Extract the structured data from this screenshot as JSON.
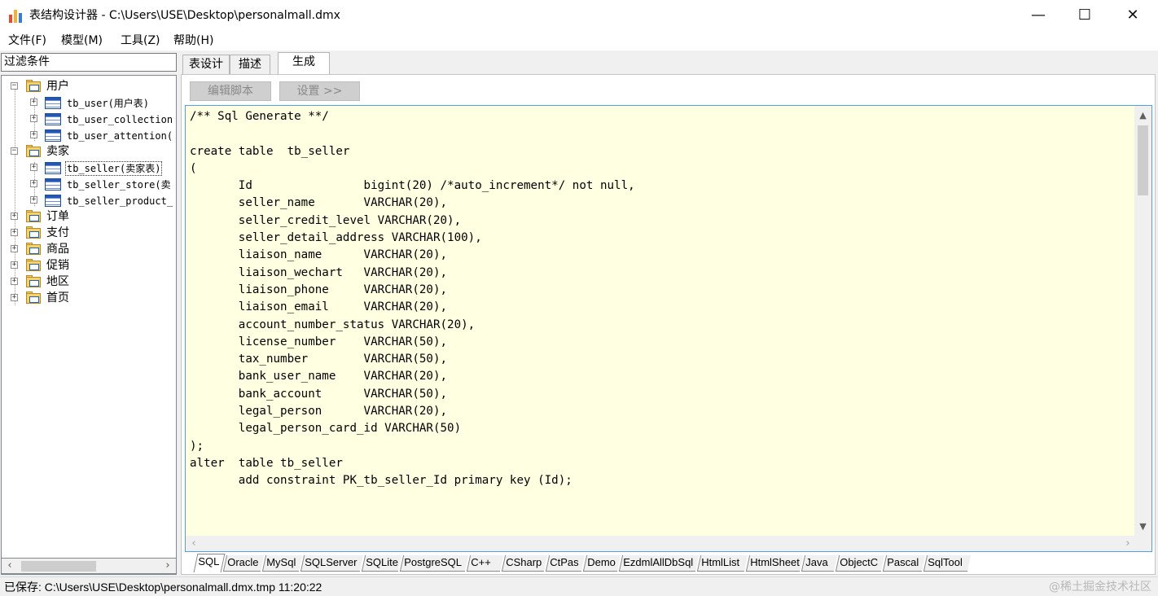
{
  "window": {
    "title": "表结构设计器 - C:\\Users\\USE\\Desktop\\personalmall.dmx",
    "controls": {
      "minimize": "—",
      "maximize": "☐",
      "close": "✕"
    }
  },
  "menu": {
    "items": [
      "文件(F)",
      "模型(M)",
      "工具(Z)",
      "帮助(H)"
    ]
  },
  "sidebar": {
    "filter_text": "过滤条件",
    "tree": [
      {
        "label": "用户",
        "type": "folder",
        "expanded": true,
        "level": 0
      },
      {
        "label": "tb_user(用户表)",
        "type": "table",
        "level": 1
      },
      {
        "label": "tb_user_collection",
        "type": "table",
        "level": 1
      },
      {
        "label": "tb_user_attention(",
        "type": "table",
        "level": 1
      },
      {
        "label": "卖家",
        "type": "folder",
        "expanded": true,
        "level": 0
      },
      {
        "label": "tb_seller(卖家表)",
        "type": "table",
        "level": 1,
        "selected": true
      },
      {
        "label": "tb_seller_store(卖",
        "type": "table",
        "level": 1
      },
      {
        "label": "tb_seller_product_",
        "type": "table",
        "level": 1
      },
      {
        "label": "订单",
        "type": "folder",
        "expanded": false,
        "level": 0
      },
      {
        "label": "支付",
        "type": "folder",
        "expanded": false,
        "level": 0
      },
      {
        "label": "商品",
        "type": "folder",
        "expanded": false,
        "level": 0
      },
      {
        "label": "促销",
        "type": "folder",
        "expanded": false,
        "level": 0
      },
      {
        "label": "地区",
        "type": "folder",
        "expanded": false,
        "level": 0
      },
      {
        "label": "首页",
        "type": "folder",
        "expanded": false,
        "level": 0
      }
    ]
  },
  "tabs": [
    {
      "label": "表设计",
      "active": false
    },
    {
      "label": "描述",
      "active": false
    },
    {
      "label": "生成",
      "active": true
    }
  ],
  "toolbar": {
    "edit_script": "编辑脚本",
    "settings": "设置 >>"
  },
  "editor": {
    "code": "/** Sql Generate **/\n\ncreate table  tb_seller\n(\n       Id                bigint(20) /*auto_increment*/ not null,\n       seller_name       VARCHAR(20),\n       seller_credit_level VARCHAR(20),\n       seller_detail_address VARCHAR(100),\n       liaison_name      VARCHAR(20),\n       liaison_wechart   VARCHAR(20),\n       liaison_phone     VARCHAR(20),\n       liaison_email     VARCHAR(20),\n       account_number_status VARCHAR(20),\n       license_number    VARCHAR(50),\n       tax_number        VARCHAR(50),\n       bank_user_name    VARCHAR(20),\n       bank_account      VARCHAR(50),\n       legal_person      VARCHAR(20),\n       legal_person_card_id VARCHAR(50)\n);\nalter  table tb_seller\n       add constraint PK_tb_seller_Id primary key (Id);"
  },
  "lang_tabs": [
    "SQL",
    "Oracle",
    "MySql",
    "SQLServer",
    "SQLite",
    "PostgreSQL",
    "C++",
    "CSharp",
    "CtPas",
    "Demo",
    "EzdmlAllDbSql",
    "HtmlList",
    "HtmlSheet",
    "Java",
    "ObjectC",
    "Pascal",
    "SqlTool"
  ],
  "lang_tabs_active": "SQL",
  "status": {
    "text": "已保存: C:\\Users\\USE\\Desktop\\personalmall.dmx.tmp 11:20:22",
    "watermark": "@稀土掘金技术社区"
  }
}
